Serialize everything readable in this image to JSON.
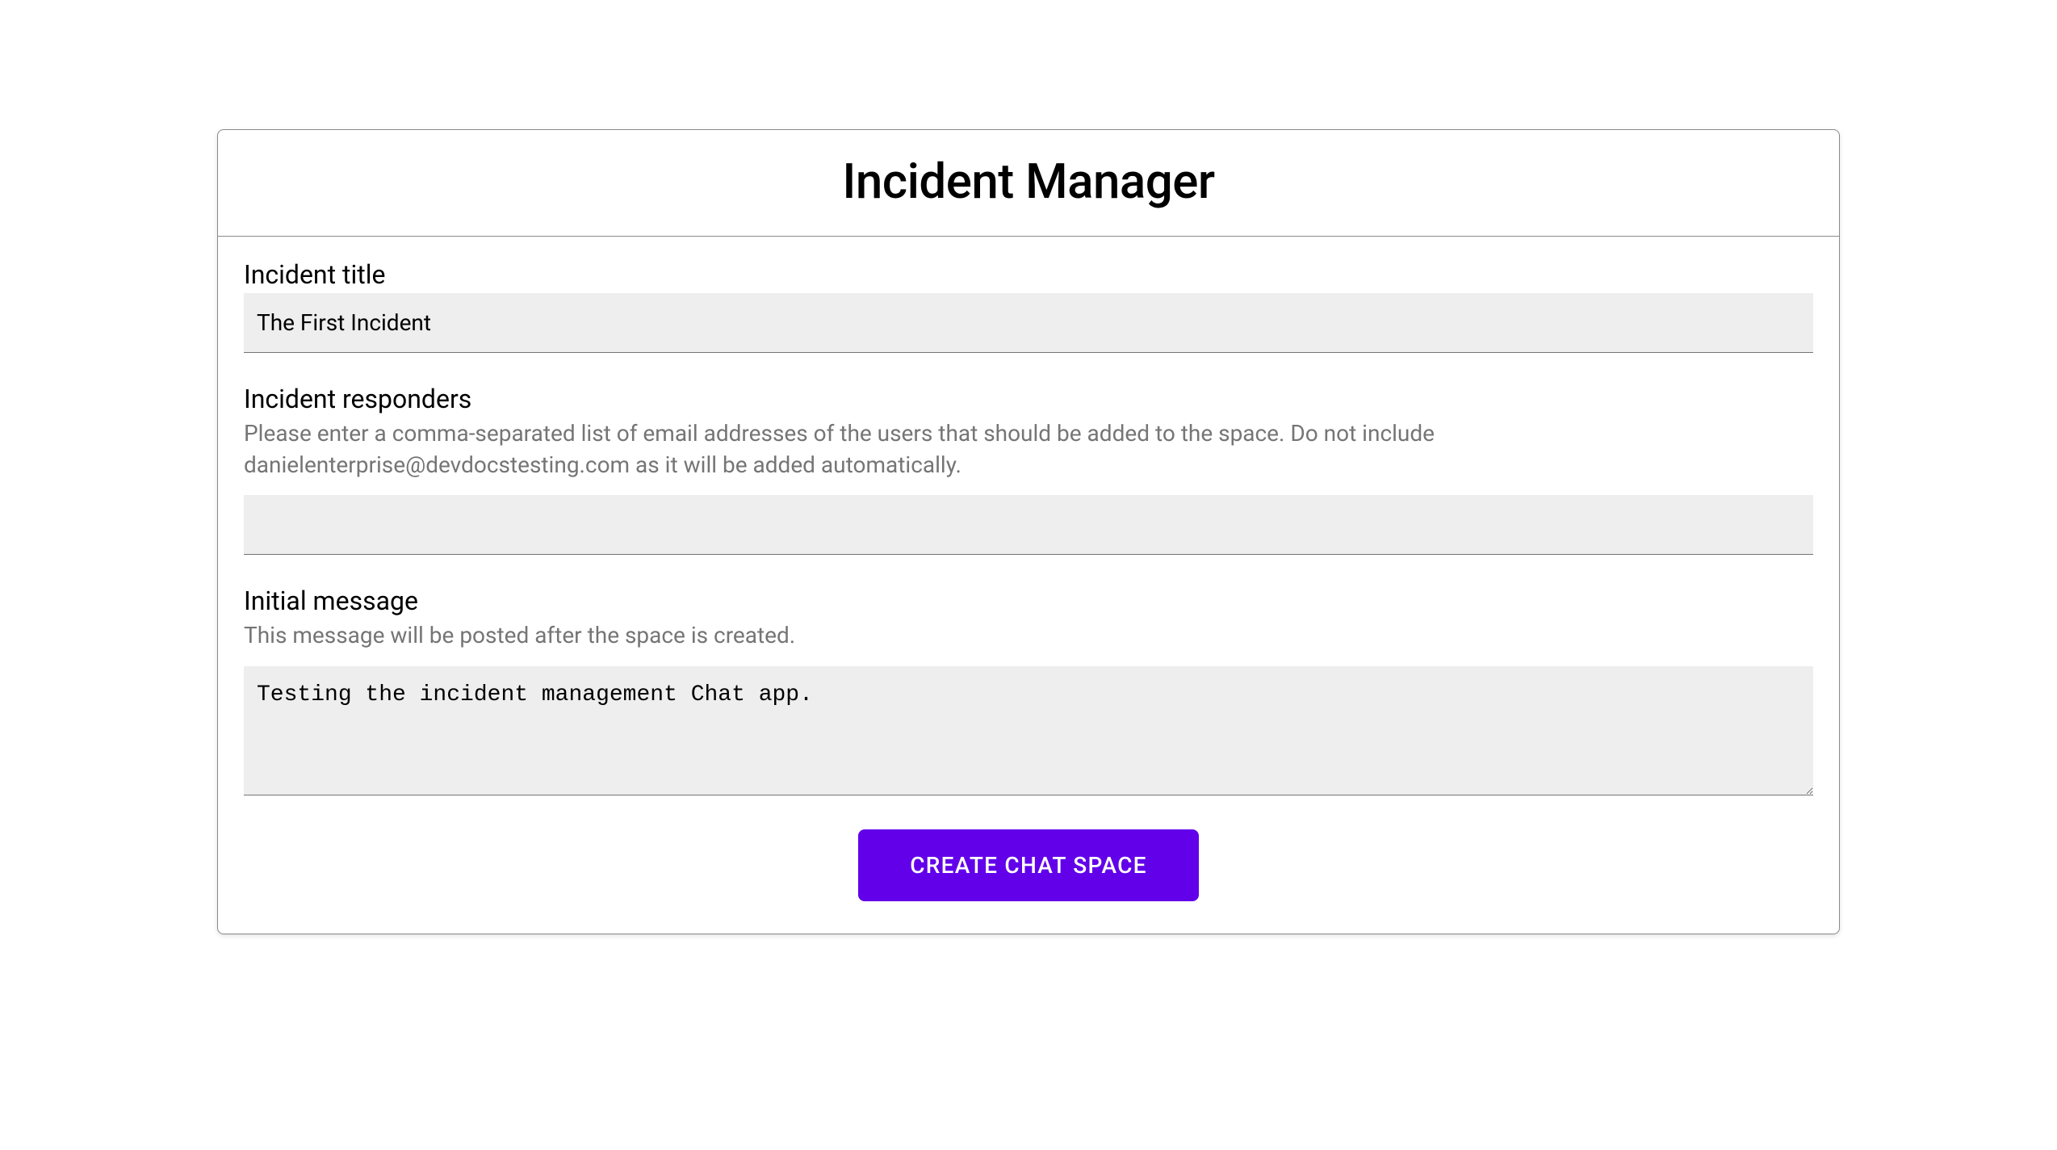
{
  "header": {
    "title": "Incident Manager"
  },
  "form": {
    "incident_title": {
      "label": "Incident title",
      "value": "The First Incident"
    },
    "incident_responders": {
      "label": "Incident responders",
      "hint": "Please enter a comma-separated list of email addresses of the users that should be added to the space. Do not include danielenterprise@devdocstesting.com as it will be added automatically.",
      "value": ""
    },
    "initial_message": {
      "label": "Initial message",
      "hint": "This message will be posted after the space is created.",
      "value": "Testing the incident management Chat app."
    },
    "submit_label": "CREATE CHAT SPACE"
  }
}
